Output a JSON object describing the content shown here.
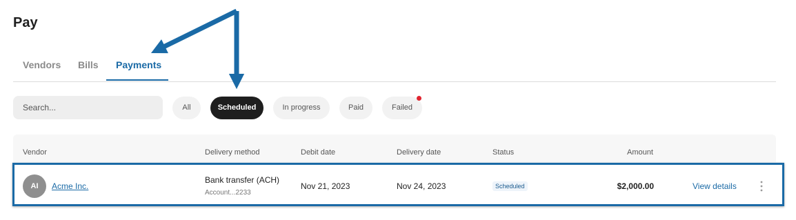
{
  "page": {
    "title": "Pay"
  },
  "tabs": [
    {
      "label": "Vendors",
      "active": false
    },
    {
      "label": "Bills",
      "active": false
    },
    {
      "label": "Payments",
      "active": true
    }
  ],
  "filters": {
    "search_placeholder": "Search...",
    "pills": [
      {
        "label": "All",
        "active": false
      },
      {
        "label": "Scheduled",
        "active": true
      },
      {
        "label": "In progress",
        "active": false
      },
      {
        "label": "Paid",
        "active": false
      },
      {
        "label": "Failed",
        "active": false,
        "has_notification": true
      }
    ]
  },
  "table": {
    "columns": [
      "Vendor",
      "Delivery method",
      "Debit date",
      "Delivery date",
      "Status",
      "Amount"
    ],
    "rows": [
      {
        "avatar_initials": "AI",
        "vendor": "Acme Inc.",
        "delivery_method": "Bank transfer (ACH)",
        "account": "Account...2233",
        "debit_date": "Nov 21, 2023",
        "delivery_date": "Nov 24, 2023",
        "status": "Scheduled",
        "amount": "$2,000.00",
        "action": "View details"
      }
    ]
  },
  "colors": {
    "accent": "#1a6aa6",
    "annotation": "#1a6aa6",
    "notification": "#e0242f",
    "active_pill": "#1e1e1e"
  }
}
